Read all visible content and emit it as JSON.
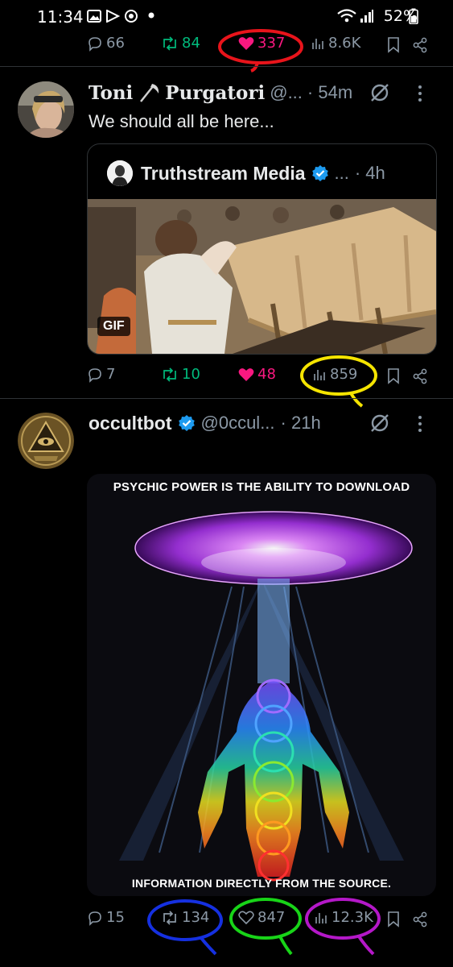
{
  "status_bar": {
    "time": "11:34",
    "battery": "52%"
  },
  "tweet_top_actions": {
    "replies": "66",
    "reposts": "84",
    "likes": "337",
    "views": "8.6K"
  },
  "tweet1": {
    "author": "Toni",
    "author_last": "Purgatori",
    "handle": "@...",
    "time": "· 54m",
    "text": "We should all be here...",
    "quote": {
      "author": "Truthstream Media",
      "handle": "...",
      "time": "· 4h",
      "media_badge": "GIF"
    },
    "actions": {
      "replies": "7",
      "reposts": "10",
      "likes": "48",
      "views": "859"
    }
  },
  "tweet2": {
    "author": "occultbot",
    "handle": "@0ccul...",
    "time": "· 21h",
    "poster_top": "PSYCHIC POWER IS THE ABILITY TO DOWNLOAD",
    "poster_bottom": "INFORMATION DIRECTLY FROM THE SOURCE.",
    "actions": {
      "replies": "15",
      "reposts": "134",
      "likes": "847",
      "views": "12.3K"
    }
  },
  "colors": {
    "annot_red": "#e8141b",
    "annot_yellow": "#f5e400",
    "annot_blue": "#1530e0",
    "annot_green": "#18d418",
    "annot_purple": "#b418c8",
    "verified": "#1d9bf0"
  }
}
